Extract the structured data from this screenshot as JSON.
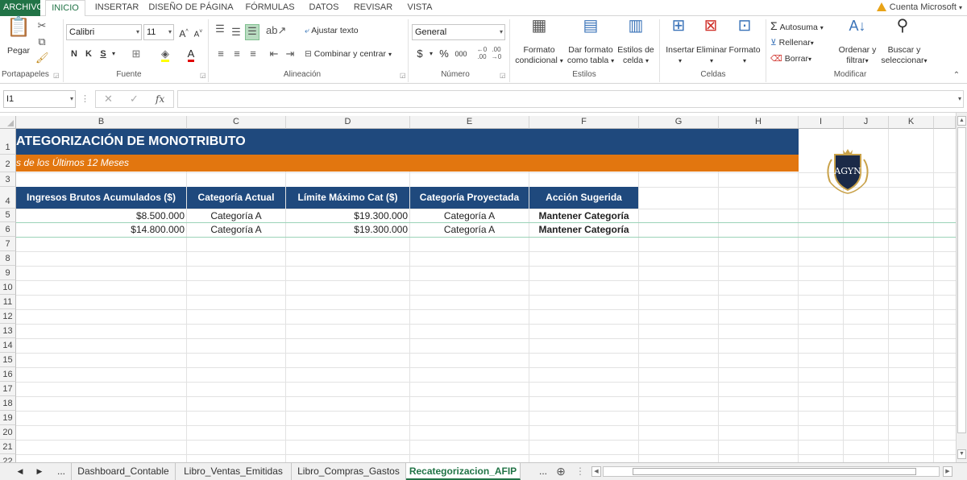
{
  "menu": {
    "tabs": [
      "ARCHIVO",
      "INICIO",
      "INSERTAR",
      "DISEÑO DE PÁGINA",
      "FÓRMULAS",
      "DATOS",
      "REVISAR",
      "VISTA"
    ],
    "account": "Cuenta Microsoft"
  },
  "ribbon": {
    "clipboard": {
      "paste": "Pegar",
      "label": "Portapapeles"
    },
    "font": {
      "name": "Calibri",
      "size": "11",
      "bold": "N",
      "italic": "K",
      "underline": "S",
      "label": "Fuente"
    },
    "alignment": {
      "wrap": "Ajustar texto",
      "merge": "Combinar y centrar",
      "label": "Alineación"
    },
    "number": {
      "format": "General",
      "currency": "$",
      "percent": "%",
      "thousands": "000",
      "label": "Número"
    },
    "styles": {
      "cond1": "Formato",
      "cond2": "condicional",
      "table1": "Dar formato",
      "table2": "como tabla",
      "cell1": "Estilos de",
      "cell2": "celda",
      "label": "Estilos"
    },
    "cells": {
      "insert": "Insertar",
      "delete": "Eliminar",
      "format": "Formato",
      "label": "Celdas"
    },
    "editing": {
      "autosum": "Autosuma",
      "fill": "Rellenar",
      "clear": "Borrar",
      "sort1": "Ordenar y",
      "sort2": "filtrar",
      "find1": "Buscar y",
      "find2": "seleccionar",
      "label": "Modificar"
    }
  },
  "formula_bar": {
    "name_box": "I1",
    "fx": "fx",
    "formula": ""
  },
  "columns": [
    "B",
    "C",
    "D",
    "E",
    "F",
    "G",
    "H",
    "I",
    "J",
    "K"
  ],
  "rows": [
    "1",
    "2",
    "3",
    "4",
    "5",
    "6",
    "7",
    "8",
    "9",
    "10",
    "11",
    "12",
    "13",
    "14",
    "15",
    "16",
    "17",
    "18",
    "19",
    "20",
    "21",
    "22"
  ],
  "sheet": {
    "title": "ATEGORIZACIÓN DE MONOTRIBUTO",
    "subtitle": "s de los Últimos 12 Meses",
    "headers": [
      "Ingresos Brutos Acumulados ($)",
      "Categoría Actual",
      "Límite Máximo Cat ($)",
      "Categoría Proyectada",
      "Acción Sugerida"
    ],
    "data": [
      [
        "$8.500.000",
        "Categoría A",
        "$19.300.000",
        "Categoría A",
        "Mantener Categoría"
      ],
      [
        "$14.800.000",
        "Categoría A",
        "$19.300.000",
        "Categoría A",
        "Mantener Categoría"
      ]
    ],
    "logo_text": "AGYN"
  },
  "sheet_tabs": {
    "items": [
      "Dashboard_Contable",
      "Libro_Ventas_Emitidas",
      "Libro_Compras_Gastos",
      "Recategorizacion_AFIP"
    ],
    "ellipsis": "..."
  },
  "colors": {
    "header_blue": "#1f497d",
    "band_orange": "#e2760f",
    "excel_green": "#217346"
  }
}
